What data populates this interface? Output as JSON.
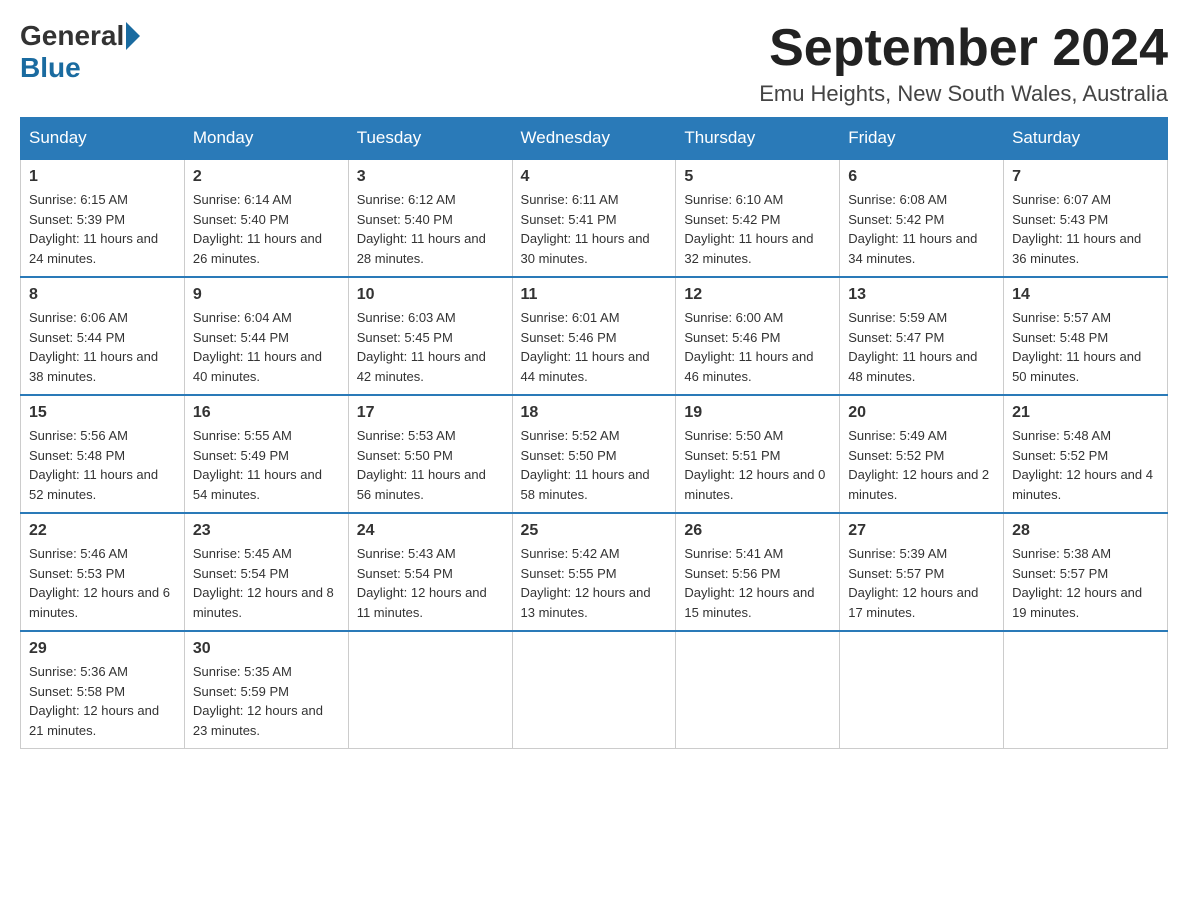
{
  "header": {
    "logo_general": "General",
    "logo_blue": "Blue",
    "month_title": "September 2024",
    "location": "Emu Heights, New South Wales, Australia"
  },
  "days_of_week": [
    "Sunday",
    "Monday",
    "Tuesday",
    "Wednesday",
    "Thursday",
    "Friday",
    "Saturday"
  ],
  "weeks": [
    [
      {
        "day": "1",
        "sunrise": "6:15 AM",
        "sunset": "5:39 PM",
        "daylight": "11 hours and 24 minutes."
      },
      {
        "day": "2",
        "sunrise": "6:14 AM",
        "sunset": "5:40 PM",
        "daylight": "11 hours and 26 minutes."
      },
      {
        "day": "3",
        "sunrise": "6:12 AM",
        "sunset": "5:40 PM",
        "daylight": "11 hours and 28 minutes."
      },
      {
        "day": "4",
        "sunrise": "6:11 AM",
        "sunset": "5:41 PM",
        "daylight": "11 hours and 30 minutes."
      },
      {
        "day": "5",
        "sunrise": "6:10 AM",
        "sunset": "5:42 PM",
        "daylight": "11 hours and 32 minutes."
      },
      {
        "day": "6",
        "sunrise": "6:08 AM",
        "sunset": "5:42 PM",
        "daylight": "11 hours and 34 minutes."
      },
      {
        "day": "7",
        "sunrise": "6:07 AM",
        "sunset": "5:43 PM",
        "daylight": "11 hours and 36 minutes."
      }
    ],
    [
      {
        "day": "8",
        "sunrise": "6:06 AM",
        "sunset": "5:44 PM",
        "daylight": "11 hours and 38 minutes."
      },
      {
        "day": "9",
        "sunrise": "6:04 AM",
        "sunset": "5:44 PM",
        "daylight": "11 hours and 40 minutes."
      },
      {
        "day": "10",
        "sunrise": "6:03 AM",
        "sunset": "5:45 PM",
        "daylight": "11 hours and 42 minutes."
      },
      {
        "day": "11",
        "sunrise": "6:01 AM",
        "sunset": "5:46 PM",
        "daylight": "11 hours and 44 minutes."
      },
      {
        "day": "12",
        "sunrise": "6:00 AM",
        "sunset": "5:46 PM",
        "daylight": "11 hours and 46 minutes."
      },
      {
        "day": "13",
        "sunrise": "5:59 AM",
        "sunset": "5:47 PM",
        "daylight": "11 hours and 48 minutes."
      },
      {
        "day": "14",
        "sunrise": "5:57 AM",
        "sunset": "5:48 PM",
        "daylight": "11 hours and 50 minutes."
      }
    ],
    [
      {
        "day": "15",
        "sunrise": "5:56 AM",
        "sunset": "5:48 PM",
        "daylight": "11 hours and 52 minutes."
      },
      {
        "day": "16",
        "sunrise": "5:55 AM",
        "sunset": "5:49 PM",
        "daylight": "11 hours and 54 minutes."
      },
      {
        "day": "17",
        "sunrise": "5:53 AM",
        "sunset": "5:50 PM",
        "daylight": "11 hours and 56 minutes."
      },
      {
        "day": "18",
        "sunrise": "5:52 AM",
        "sunset": "5:50 PM",
        "daylight": "11 hours and 58 minutes."
      },
      {
        "day": "19",
        "sunrise": "5:50 AM",
        "sunset": "5:51 PM",
        "daylight": "12 hours and 0 minutes."
      },
      {
        "day": "20",
        "sunrise": "5:49 AM",
        "sunset": "5:52 PM",
        "daylight": "12 hours and 2 minutes."
      },
      {
        "day": "21",
        "sunrise": "5:48 AM",
        "sunset": "5:52 PM",
        "daylight": "12 hours and 4 minutes."
      }
    ],
    [
      {
        "day": "22",
        "sunrise": "5:46 AM",
        "sunset": "5:53 PM",
        "daylight": "12 hours and 6 minutes."
      },
      {
        "day": "23",
        "sunrise": "5:45 AM",
        "sunset": "5:54 PM",
        "daylight": "12 hours and 8 minutes."
      },
      {
        "day": "24",
        "sunrise": "5:43 AM",
        "sunset": "5:54 PM",
        "daylight": "12 hours and 11 minutes."
      },
      {
        "day": "25",
        "sunrise": "5:42 AM",
        "sunset": "5:55 PM",
        "daylight": "12 hours and 13 minutes."
      },
      {
        "day": "26",
        "sunrise": "5:41 AM",
        "sunset": "5:56 PM",
        "daylight": "12 hours and 15 minutes."
      },
      {
        "day": "27",
        "sunrise": "5:39 AM",
        "sunset": "5:57 PM",
        "daylight": "12 hours and 17 minutes."
      },
      {
        "day": "28",
        "sunrise": "5:38 AM",
        "sunset": "5:57 PM",
        "daylight": "12 hours and 19 minutes."
      }
    ],
    [
      {
        "day": "29",
        "sunrise": "5:36 AM",
        "sunset": "5:58 PM",
        "daylight": "12 hours and 21 minutes."
      },
      {
        "day": "30",
        "sunrise": "5:35 AM",
        "sunset": "5:59 PM",
        "daylight": "12 hours and 23 minutes."
      },
      null,
      null,
      null,
      null,
      null
    ]
  ]
}
